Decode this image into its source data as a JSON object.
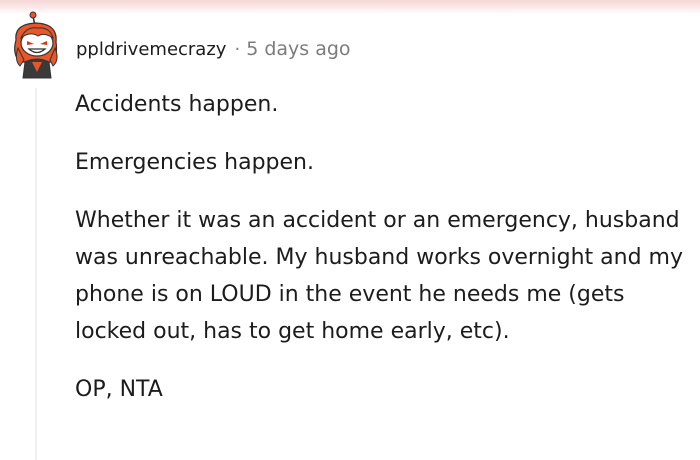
{
  "comment": {
    "author": "ppldrivemecrazy",
    "separator": "·",
    "timestamp": "5 days ago",
    "paragraphs": [
      "Accidents happen.",
      "Emergencies happen.",
      "Whether it was an accident or an emergency, husband was unreachable. My husband works overnight and my phone is on LOUD in the event he needs me (gets locked out, has to get home early, etc).",
      "OP, NTA"
    ]
  },
  "icons": {
    "avatar": "snoo-avatar-icon"
  },
  "colors": {
    "text": "#1c1c1c",
    "meta": "#7c7c7c",
    "thread_line": "#edeff1",
    "avatar_accent": "#e8562a"
  }
}
